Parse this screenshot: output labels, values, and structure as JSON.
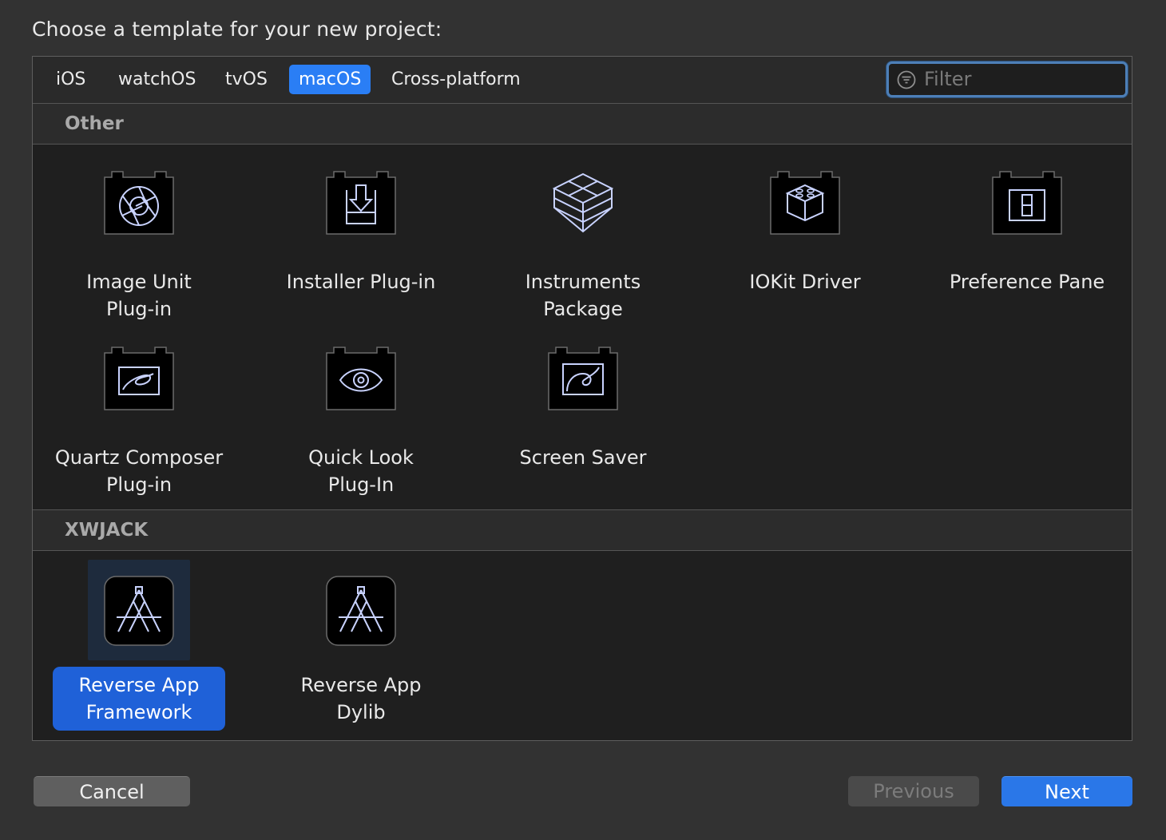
{
  "header": {
    "title": "Choose a template for your new project:"
  },
  "tabs": [
    {
      "label": "iOS",
      "active": false
    },
    {
      "label": "watchOS",
      "active": false
    },
    {
      "label": "tvOS",
      "active": false
    },
    {
      "label": "macOS",
      "active": true
    },
    {
      "label": "Cross-platform",
      "active": false
    }
  ],
  "filter": {
    "placeholder": "Filter",
    "icon": "filter-icon"
  },
  "sections": [
    {
      "name": "Other",
      "templates": [
        {
          "label": "Image Unit\nPlug-in",
          "icon": "aperture-icon"
        },
        {
          "label": "Installer Plug-in",
          "icon": "install-arrow-icon"
        },
        {
          "label": "Instruments\nPackage",
          "icon": "stacked-boxes-icon"
        },
        {
          "label": "IOKit Driver",
          "icon": "lego-block-icon"
        },
        {
          "label": "Preference Pane",
          "icon": "switch-icon"
        },
        {
          "label": "Quartz Composer\nPlug-in",
          "icon": "quartz-icon"
        },
        {
          "label": "Quick Look\nPlug-In",
          "icon": "eye-icon"
        },
        {
          "label": "Screen Saver",
          "icon": "spiral-icon"
        }
      ]
    },
    {
      "name": "XWJACK",
      "templates": [
        {
          "label": "Reverse App\nFramework",
          "icon": "app-store-icon",
          "selected": true
        },
        {
          "label": "Reverse App Dylib",
          "icon": "app-store-icon",
          "selected": false
        }
      ]
    }
  ],
  "buttons": {
    "cancel": "Cancel",
    "previous": "Previous",
    "next": "Next"
  },
  "colors": {
    "accent": "#2a7ef5",
    "selection": "#1f61d8",
    "icon_stroke": "#c9d3ff"
  }
}
